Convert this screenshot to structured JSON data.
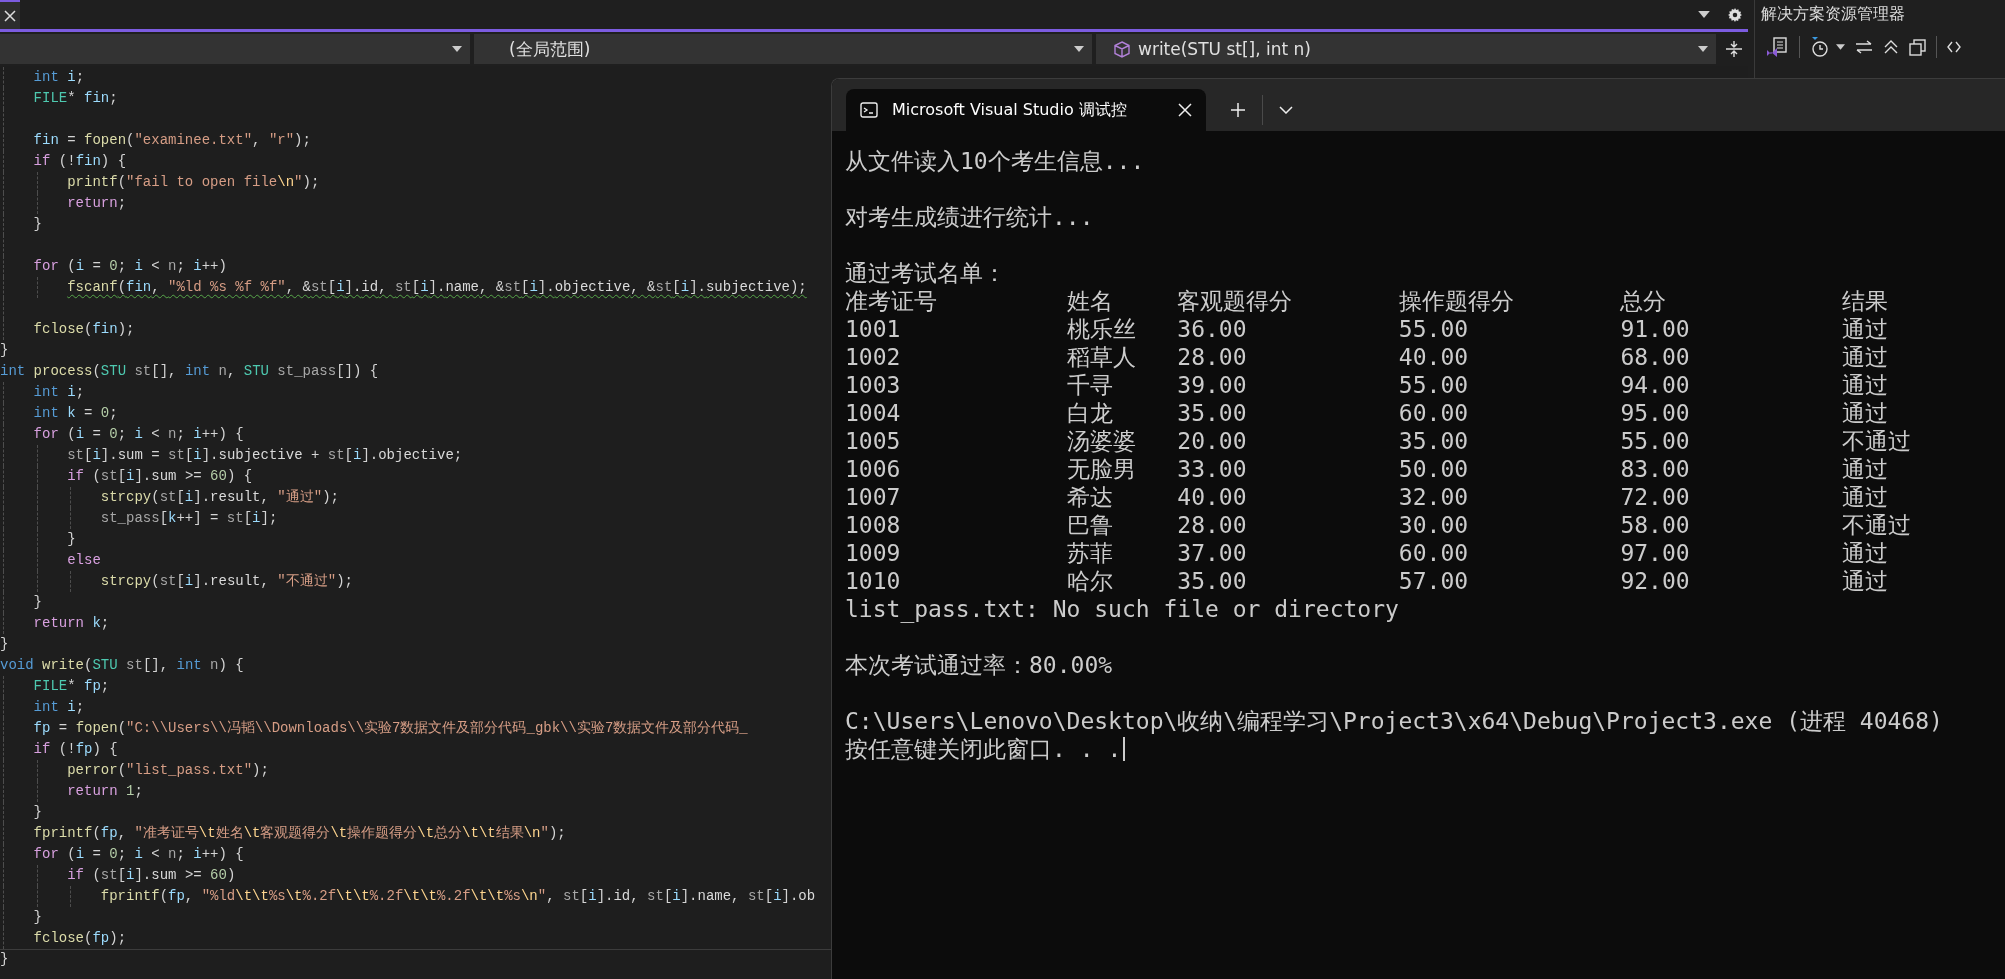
{
  "navigation": {
    "scope": "(全局范围)",
    "member": "write(STU st[], int n)"
  },
  "code_lines": [
    {
      "kind": "code",
      "tokens": [
        {
          "kind": "k",
          "text": "    int"
        },
        {
          "kind": "v",
          "text": " i"
        },
        {
          "kind": "o",
          "text": ";"
        }
      ]
    },
    {
      "kind": "code",
      "tokens": [
        {
          "kind": "t",
          "text": "    FILE"
        },
        {
          "kind": "o",
          "text": "* "
        },
        {
          "kind": "v",
          "text": "fin"
        },
        {
          "kind": "o",
          "text": ";"
        }
      ]
    },
    {
      "kind": "blank"
    },
    {
      "kind": "code",
      "tokens": [
        {
          "kind": "v",
          "text": "    fin"
        },
        {
          "kind": "o",
          "text": " = "
        },
        {
          "kind": "f",
          "text": "fopen"
        },
        {
          "kind": "o",
          "text": "("
        },
        {
          "kind": "s",
          "text": "\"examinee.txt\""
        },
        {
          "kind": "o",
          "text": ", "
        },
        {
          "kind": "s",
          "text": "\"r\""
        },
        {
          "kind": "o",
          "text": ");"
        }
      ]
    },
    {
      "kind": "code",
      "tokens": [
        {
          "kind": "c",
          "text": "    if"
        },
        {
          "kind": "o",
          "text": " (!"
        },
        {
          "kind": "v",
          "text": "fin"
        },
        {
          "kind": "o",
          "text": ") {"
        }
      ]
    },
    {
      "kind": "code",
      "tokens": [
        {
          "kind": "f",
          "text": "        printf"
        },
        {
          "kind": "o",
          "text": "("
        },
        {
          "kind": "s",
          "text": "\"fail to open file"
        },
        {
          "kind": "e",
          "text": "\\n"
        },
        {
          "kind": "s",
          "text": "\""
        },
        {
          "kind": "o",
          "text": ");"
        }
      ]
    },
    {
      "kind": "code",
      "tokens": [
        {
          "kind": "c",
          "text": "        return"
        },
        {
          "kind": "o",
          "text": ";"
        }
      ]
    },
    {
      "kind": "code",
      "tokens": [
        {
          "kind": "o",
          "text": "    }"
        }
      ]
    },
    {
      "kind": "blank"
    },
    {
      "kind": "code",
      "tokens": [
        {
          "kind": "c",
          "text": "    for"
        },
        {
          "kind": "o",
          "text": " ("
        },
        {
          "kind": "v",
          "text": "i"
        },
        {
          "kind": "o",
          "text": " = "
        },
        {
          "kind": "n",
          "text": "0"
        },
        {
          "kind": "o",
          "text": "; "
        },
        {
          "kind": "v",
          "text": "i"
        },
        {
          "kind": "o",
          "text": " < "
        },
        {
          "kind": "p",
          "text": "n"
        },
        {
          "kind": "o",
          "text": "; "
        },
        {
          "kind": "v",
          "text": "i"
        },
        {
          "kind": "o",
          "text": "++)"
        }
      ]
    },
    {
      "kind": "warn",
      "tokens": [
        {
          "kind": "f",
          "text": "        fscanf"
        },
        {
          "kind": "o",
          "text": "("
        },
        {
          "kind": "v",
          "text": "fin"
        },
        {
          "kind": "o",
          "text": ", "
        },
        {
          "kind": "s",
          "text": "\"%ld %s %f %f\""
        },
        {
          "kind": "o",
          "text": ", &"
        },
        {
          "kind": "p",
          "text": "st"
        },
        {
          "kind": "o",
          "text": "["
        },
        {
          "kind": "v",
          "text": "i"
        },
        {
          "kind": "o",
          "text": "]."
        },
        {
          "kind": "m",
          "text": "id"
        },
        {
          "kind": "o",
          "text": ", "
        },
        {
          "kind": "p",
          "text": "st"
        },
        {
          "kind": "o",
          "text": "["
        },
        {
          "kind": "v",
          "text": "i"
        },
        {
          "kind": "o",
          "text": "]."
        },
        {
          "kind": "m",
          "text": "name"
        },
        {
          "kind": "o",
          "text": ", &"
        },
        {
          "kind": "p",
          "text": "st"
        },
        {
          "kind": "o",
          "text": "["
        },
        {
          "kind": "v",
          "text": "i"
        },
        {
          "kind": "o",
          "text": "]."
        },
        {
          "kind": "m",
          "text": "objective"
        },
        {
          "kind": "o",
          "text": ", &"
        },
        {
          "kind": "p",
          "text": "st"
        },
        {
          "kind": "o",
          "text": "["
        },
        {
          "kind": "v",
          "text": "i"
        },
        {
          "kind": "o",
          "text": "]."
        },
        {
          "kind": "m",
          "text": "subjective"
        },
        {
          "kind": "o",
          "text": ");"
        }
      ]
    },
    {
      "kind": "blank"
    },
    {
      "kind": "code",
      "tokens": [
        {
          "kind": "f",
          "text": "    fclose"
        },
        {
          "kind": "o",
          "text": "("
        },
        {
          "kind": "v",
          "text": "fin"
        },
        {
          "kind": "o",
          "text": ");"
        }
      ]
    },
    {
      "kind": "code",
      "tokens": [
        {
          "kind": "o",
          "text": "}"
        }
      ]
    },
    {
      "kind": "code",
      "tokens": [
        {
          "kind": "k",
          "text": "int"
        },
        {
          "kind": "f",
          "text": " process"
        },
        {
          "kind": "o",
          "text": "("
        },
        {
          "kind": "t",
          "text": "STU"
        },
        {
          "kind": "p",
          "text": " st"
        },
        {
          "kind": "o",
          "text": "[], "
        },
        {
          "kind": "k",
          "text": "int"
        },
        {
          "kind": "p",
          "text": " n"
        },
        {
          "kind": "o",
          "text": ", "
        },
        {
          "kind": "t",
          "text": "STU"
        },
        {
          "kind": "p",
          "text": " st_pass"
        },
        {
          "kind": "o",
          "text": "[]) {"
        }
      ]
    },
    {
      "kind": "code",
      "tokens": [
        {
          "kind": "k",
          "text": "    int"
        },
        {
          "kind": "v",
          "text": " i"
        },
        {
          "kind": "o",
          "text": ";"
        }
      ]
    },
    {
      "kind": "code",
      "tokens": [
        {
          "kind": "k",
          "text": "    int"
        },
        {
          "kind": "v",
          "text": " k"
        },
        {
          "kind": "o",
          "text": " = "
        },
        {
          "kind": "n",
          "text": "0"
        },
        {
          "kind": "o",
          "text": ";"
        }
      ]
    },
    {
      "kind": "code",
      "tokens": [
        {
          "kind": "c",
          "text": "    for"
        },
        {
          "kind": "o",
          "text": " ("
        },
        {
          "kind": "v",
          "text": "i"
        },
        {
          "kind": "o",
          "text": " = "
        },
        {
          "kind": "n",
          "text": "0"
        },
        {
          "kind": "o",
          "text": "; "
        },
        {
          "kind": "v",
          "text": "i"
        },
        {
          "kind": "o",
          "text": " < "
        },
        {
          "kind": "p",
          "text": "n"
        },
        {
          "kind": "o",
          "text": "; "
        },
        {
          "kind": "v",
          "text": "i"
        },
        {
          "kind": "o",
          "text": "++) {"
        }
      ]
    },
    {
      "kind": "code",
      "tokens": [
        {
          "kind": "p",
          "text": "        st"
        },
        {
          "kind": "o",
          "text": "["
        },
        {
          "kind": "v",
          "text": "i"
        },
        {
          "kind": "o",
          "text": "]."
        },
        {
          "kind": "m",
          "text": "sum"
        },
        {
          "kind": "o",
          "text": " = "
        },
        {
          "kind": "p",
          "text": "st"
        },
        {
          "kind": "o",
          "text": "["
        },
        {
          "kind": "v",
          "text": "i"
        },
        {
          "kind": "o",
          "text": "]."
        },
        {
          "kind": "m",
          "text": "subjective"
        },
        {
          "kind": "o",
          "text": " + "
        },
        {
          "kind": "p",
          "text": "st"
        },
        {
          "kind": "o",
          "text": "["
        },
        {
          "kind": "v",
          "text": "i"
        },
        {
          "kind": "o",
          "text": "]."
        },
        {
          "kind": "m",
          "text": "objective"
        },
        {
          "kind": "o",
          "text": ";"
        }
      ]
    },
    {
      "kind": "code",
      "tokens": [
        {
          "kind": "c",
          "text": "        if"
        },
        {
          "kind": "o",
          "text": " ("
        },
        {
          "kind": "p",
          "text": "st"
        },
        {
          "kind": "o",
          "text": "["
        },
        {
          "kind": "v",
          "text": "i"
        },
        {
          "kind": "o",
          "text": "]."
        },
        {
          "kind": "m",
          "text": "sum"
        },
        {
          "kind": "o",
          "text": " >= "
        },
        {
          "kind": "n",
          "text": "60"
        },
        {
          "kind": "o",
          "text": ") {"
        }
      ]
    },
    {
      "kind": "code",
      "tokens": [
        {
          "kind": "f",
          "text": "            strcpy"
        },
        {
          "kind": "o",
          "text": "("
        },
        {
          "kind": "p",
          "text": "st"
        },
        {
          "kind": "o",
          "text": "["
        },
        {
          "kind": "v",
          "text": "i"
        },
        {
          "kind": "o",
          "text": "]."
        },
        {
          "kind": "m",
          "text": "result"
        },
        {
          "kind": "o",
          "text": ", "
        },
        {
          "kind": "s",
          "text": "\"通过\""
        },
        {
          "kind": "o",
          "text": ");"
        }
      ]
    },
    {
      "kind": "code",
      "tokens": [
        {
          "kind": "p",
          "text": "            st_pass"
        },
        {
          "kind": "o",
          "text": "["
        },
        {
          "kind": "v",
          "text": "k"
        },
        {
          "kind": "o",
          "text": "++] = "
        },
        {
          "kind": "p",
          "text": "st"
        },
        {
          "kind": "o",
          "text": "["
        },
        {
          "kind": "v",
          "text": "i"
        },
        {
          "kind": "o",
          "text": "];"
        }
      ]
    },
    {
      "kind": "code",
      "tokens": [
        {
          "kind": "o",
          "text": "        }"
        }
      ]
    },
    {
      "kind": "code",
      "tokens": [
        {
          "kind": "c",
          "text": "        else"
        }
      ]
    },
    {
      "kind": "code",
      "tokens": [
        {
          "kind": "f",
          "text": "            strcpy"
        },
        {
          "kind": "o",
          "text": "("
        },
        {
          "kind": "p",
          "text": "st"
        },
        {
          "kind": "o",
          "text": "["
        },
        {
          "kind": "v",
          "text": "i"
        },
        {
          "kind": "o",
          "text": "]."
        },
        {
          "kind": "m",
          "text": "result"
        },
        {
          "kind": "o",
          "text": ", "
        },
        {
          "kind": "s",
          "text": "\"不通过\""
        },
        {
          "kind": "o",
          "text": ");"
        }
      ]
    },
    {
      "kind": "code",
      "tokens": [
        {
          "kind": "o",
          "text": "    }"
        }
      ]
    },
    {
      "kind": "code",
      "tokens": [
        {
          "kind": "c",
          "text": "    return"
        },
        {
          "kind": "v",
          "text": " k"
        },
        {
          "kind": "o",
          "text": ";"
        }
      ]
    },
    {
      "kind": "code",
      "tokens": [
        {
          "kind": "o",
          "text": "}"
        }
      ]
    },
    {
      "kind": "code",
      "tokens": [
        {
          "kind": "k",
          "text": "void"
        },
        {
          "kind": "f",
          "text": " write"
        },
        {
          "kind": "o",
          "text": "("
        },
        {
          "kind": "t",
          "text": "STU"
        },
        {
          "kind": "p",
          "text": " st"
        },
        {
          "kind": "o",
          "text": "[], "
        },
        {
          "kind": "k",
          "text": "int"
        },
        {
          "kind": "p",
          "text": " n"
        },
        {
          "kind": "o",
          "text": ") {"
        }
      ]
    },
    {
      "kind": "code",
      "tokens": [
        {
          "kind": "t",
          "text": "    FILE"
        },
        {
          "kind": "o",
          "text": "* "
        },
        {
          "kind": "v",
          "text": "fp"
        },
        {
          "kind": "o",
          "text": ";"
        }
      ]
    },
    {
      "kind": "code",
      "tokens": [
        {
          "kind": "k",
          "text": "    int"
        },
        {
          "kind": "v",
          "text": " i"
        },
        {
          "kind": "o",
          "text": ";"
        }
      ]
    },
    {
      "kind": "code",
      "tokens": [
        {
          "kind": "v",
          "text": "    fp"
        },
        {
          "kind": "o",
          "text": " = "
        },
        {
          "kind": "f",
          "text": "fopen"
        },
        {
          "kind": "o",
          "text": "("
        },
        {
          "kind": "s",
          "text": "\"C:\\\\Users\\\\冯韬\\\\Downloads\\\\实验7数据文件及部分代码_gbk\\\\实验7数据文件及部分代码_"
        }
      ]
    },
    {
      "kind": "code",
      "tokens": [
        {
          "kind": "c",
          "text": "    if"
        },
        {
          "kind": "o",
          "text": " (!"
        },
        {
          "kind": "v",
          "text": "fp"
        },
        {
          "kind": "o",
          "text": ") {"
        }
      ]
    },
    {
      "kind": "code",
      "tokens": [
        {
          "kind": "f",
          "text": "        perror"
        },
        {
          "kind": "o",
          "text": "("
        },
        {
          "kind": "s",
          "text": "\"list_pass.txt\""
        },
        {
          "kind": "o",
          "text": ");"
        }
      ]
    },
    {
      "kind": "code",
      "tokens": [
        {
          "kind": "c",
          "text": "        return"
        },
        {
          "kind": "n",
          "text": " 1"
        },
        {
          "kind": "o",
          "text": ";"
        }
      ]
    },
    {
      "kind": "code",
      "tokens": [
        {
          "kind": "o",
          "text": "    }"
        }
      ]
    },
    {
      "kind": "code",
      "tokens": [
        {
          "kind": "f",
          "text": "    fprintf"
        },
        {
          "kind": "o",
          "text": "("
        },
        {
          "kind": "v",
          "text": "fp"
        },
        {
          "kind": "o",
          "text": ", "
        },
        {
          "kind": "s",
          "text": "\"准考证号"
        },
        {
          "kind": "e",
          "text": "\\t"
        },
        {
          "kind": "s",
          "text": "姓名"
        },
        {
          "kind": "e",
          "text": "\\t"
        },
        {
          "kind": "s",
          "text": "客观题得分"
        },
        {
          "kind": "e",
          "text": "\\t"
        },
        {
          "kind": "s",
          "text": "操作题得分"
        },
        {
          "kind": "e",
          "text": "\\t"
        },
        {
          "kind": "s",
          "text": "总分"
        },
        {
          "kind": "e",
          "text": "\\t\\t"
        },
        {
          "kind": "s",
          "text": "结果"
        },
        {
          "kind": "e",
          "text": "\\n"
        },
        {
          "kind": "s",
          "text": "\""
        },
        {
          "kind": "o",
          "text": ");"
        }
      ]
    },
    {
      "kind": "code",
      "tokens": [
        {
          "kind": "c",
          "text": "    for"
        },
        {
          "kind": "o",
          "text": " ("
        },
        {
          "kind": "v",
          "text": "i"
        },
        {
          "kind": "o",
          "text": " = "
        },
        {
          "kind": "n",
          "text": "0"
        },
        {
          "kind": "o",
          "text": "; "
        },
        {
          "kind": "v",
          "text": "i"
        },
        {
          "kind": "o",
          "text": " < "
        },
        {
          "kind": "p",
          "text": "n"
        },
        {
          "kind": "o",
          "text": "; "
        },
        {
          "kind": "v",
          "text": "i"
        },
        {
          "kind": "o",
          "text": "++) {"
        }
      ]
    },
    {
      "kind": "code",
      "tokens": [
        {
          "kind": "c",
          "text": "        if"
        },
        {
          "kind": "o",
          "text": " ("
        },
        {
          "kind": "p",
          "text": "st"
        },
        {
          "kind": "o",
          "text": "["
        },
        {
          "kind": "v",
          "text": "i"
        },
        {
          "kind": "o",
          "text": "]."
        },
        {
          "kind": "m",
          "text": "sum"
        },
        {
          "kind": "o",
          "text": " >= "
        },
        {
          "kind": "n",
          "text": "60"
        },
        {
          "kind": "o",
          "text": ")"
        }
      ]
    },
    {
      "kind": "code",
      "tokens": [
        {
          "kind": "f",
          "text": "            fprintf"
        },
        {
          "kind": "o",
          "text": "("
        },
        {
          "kind": "v",
          "text": "fp"
        },
        {
          "kind": "o",
          "text": ", "
        },
        {
          "kind": "s",
          "text": "\"%ld"
        },
        {
          "kind": "e",
          "text": "\\t\\t"
        },
        {
          "kind": "s",
          "text": "%s"
        },
        {
          "kind": "e",
          "text": "\\t"
        },
        {
          "kind": "s",
          "text": "%.2f"
        },
        {
          "kind": "e",
          "text": "\\t\\t"
        },
        {
          "kind": "s",
          "text": "%.2f"
        },
        {
          "kind": "e",
          "text": "\\t\\t"
        },
        {
          "kind": "s",
          "text": "%.2f"
        },
        {
          "kind": "e",
          "text": "\\t\\t"
        },
        {
          "kind": "s",
          "text": "%s"
        },
        {
          "kind": "e",
          "text": "\\n"
        },
        {
          "kind": "s",
          "text": "\""
        },
        {
          "kind": "o",
          "text": ", "
        },
        {
          "kind": "p",
          "text": "st"
        },
        {
          "kind": "o",
          "text": "["
        },
        {
          "kind": "v",
          "text": "i"
        },
        {
          "kind": "o",
          "text": "]."
        },
        {
          "kind": "m",
          "text": "id"
        },
        {
          "kind": "o",
          "text": ", "
        },
        {
          "kind": "p",
          "text": "st"
        },
        {
          "kind": "o",
          "text": "["
        },
        {
          "kind": "v",
          "text": "i"
        },
        {
          "kind": "o",
          "text": "]."
        },
        {
          "kind": "m",
          "text": "name"
        },
        {
          "kind": "o",
          "text": ", "
        },
        {
          "kind": "p",
          "text": "st"
        },
        {
          "kind": "o",
          "text": "["
        },
        {
          "kind": "v",
          "text": "i"
        },
        {
          "kind": "o",
          "text": "]."
        },
        {
          "kind": "m",
          "text": "ob"
        }
      ]
    },
    {
      "kind": "code",
      "tokens": [
        {
          "kind": "o",
          "text": "    }"
        }
      ]
    },
    {
      "kind": "code",
      "tokens": [
        {
          "kind": "f",
          "text": "    fclose"
        },
        {
          "kind": "o",
          "text": "("
        },
        {
          "kind": "v",
          "text": "fp"
        },
        {
          "kind": "o",
          "text": ");"
        }
      ]
    },
    {
      "kind": "code",
      "tokens": [
        {
          "kind": "o",
          "text": "}"
        }
      ]
    }
  ],
  "solution_explorer": {
    "title": "解决方案资源管理器"
  },
  "console": {
    "title": "Microsoft Visual Studio 调试控",
    "output": [
      {
        "kind": "text",
        "text": "从文件读入10个考生信息..."
      },
      {
        "kind": "blank"
      },
      {
        "kind": "text",
        "text": "对考生成绩进行统计..."
      },
      {
        "kind": "blank"
      },
      {
        "kind": "text",
        "text": "通过考试名单："
      },
      {
        "kind": "table",
        "columns": [
          "准考证号",
          "姓名",
          "客观题得分",
          "操作题得分",
          "总分",
          "结果"
        ],
        "rows": [
          [
            "1001",
            "桃乐丝",
            "36.00",
            "55.00",
            "91.00",
            "通过"
          ],
          [
            "1002",
            "稻草人",
            "28.00",
            "40.00",
            "68.00",
            "通过"
          ],
          [
            "1003",
            "千寻",
            "39.00",
            "55.00",
            "94.00",
            "通过"
          ],
          [
            "1004",
            "白龙",
            "35.00",
            "60.00",
            "95.00",
            "通过"
          ],
          [
            "1005",
            "汤婆婆",
            "20.00",
            "35.00",
            "55.00",
            "不通过"
          ],
          [
            "1006",
            "无脸男",
            "33.00",
            "50.00",
            "83.00",
            "通过"
          ],
          [
            "1007",
            "希达",
            "40.00",
            "32.00",
            "72.00",
            "通过"
          ],
          [
            "1008",
            "巴鲁",
            "28.00",
            "30.00",
            "58.00",
            "不通过"
          ],
          [
            "1009",
            "苏菲",
            "37.00",
            "60.00",
            "97.00",
            "通过"
          ],
          [
            "1010",
            "哈尔",
            "35.00",
            "57.00",
            "92.00",
            "通过"
          ]
        ]
      },
      {
        "kind": "text",
        "text": "list_pass.txt: No such file or directory"
      },
      {
        "kind": "blank"
      },
      {
        "kind": "text",
        "text": "本次考试通过率：80.00%"
      },
      {
        "kind": "blank"
      },
      {
        "kind": "text",
        "text": "C:\\Users\\Lenovo\\Desktop\\收纳\\编程学习\\Project3\\x64\\Debug\\Project3.exe (进程 40468)"
      },
      {
        "kind": "prompt",
        "text": "按任意键关闭此窗口. . ."
      }
    ]
  }
}
